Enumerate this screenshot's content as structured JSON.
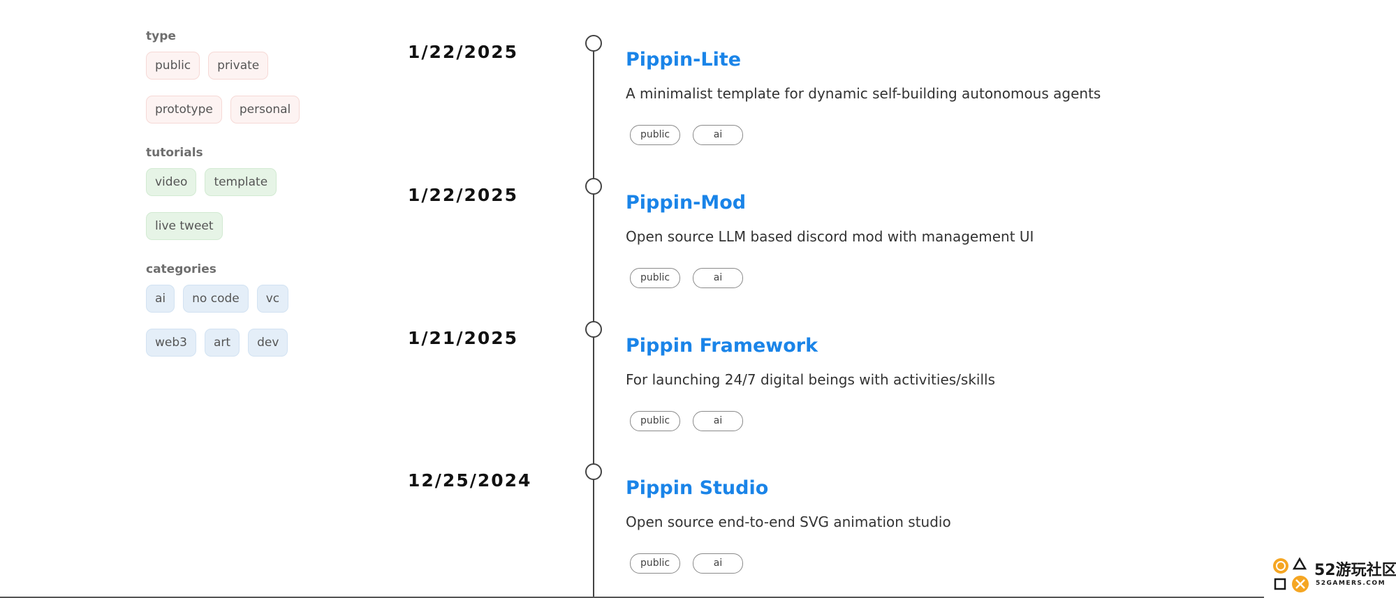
{
  "filters": {
    "type": {
      "heading": "type",
      "chips": [
        "public",
        "private",
        "prototype",
        "personal"
      ]
    },
    "tutorials": {
      "heading": "tutorials",
      "chips": [
        "video",
        "template",
        "live tweet"
      ]
    },
    "categories": {
      "heading": "categories",
      "chips": [
        "ai",
        "no code",
        "vc",
        "web3",
        "art",
        "dev"
      ]
    }
  },
  "timeline": [
    {
      "date": "1/22/2025",
      "title": "Pippin-Lite",
      "description": "A minimalist template for dynamic self-building autonomous agents",
      "tags": [
        "public",
        "ai"
      ]
    },
    {
      "date": "1/22/2025",
      "title": "Pippin-Mod",
      "description": "Open source LLM based discord mod with management UI",
      "tags": [
        "public",
        "ai"
      ]
    },
    {
      "date": "1/21/2025",
      "title": "Pippin Framework",
      "description": "For launching 24/7 digital beings with activities/skills",
      "tags": [
        "public",
        "ai"
      ]
    },
    {
      "date": "12/25/2024",
      "title": "Pippin Studio",
      "description": "Open source end-to-end SVG animation studio",
      "tags": [
        "public",
        "ai"
      ]
    }
  ],
  "watermark": {
    "text": "52游玩社区",
    "subtext": "52GAMERS.COM"
  },
  "colors": {
    "title_blue": "#1a84e8",
    "type_chip_bg": "#fdf3f2",
    "tutorials_chip_bg": "#e6f4e6",
    "categories_chip_bg": "#e4eef8",
    "watermark_orange": "#f5a623"
  }
}
